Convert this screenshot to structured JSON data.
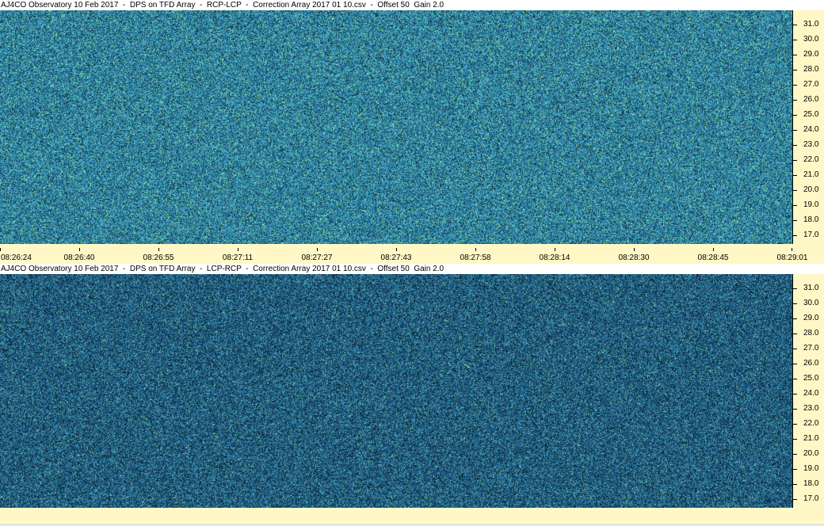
{
  "panels": [
    {
      "title": "AJ4CO Observatory 10 Feb 2017  -  DPS on TFD Array  -  RCP-LCP  -  Correction Array 2017 01 10.csv  -  Offset 50  Gain 2.0",
      "freq_labels": [
        "31.0",
        "30.0",
        "29.0",
        "28.0",
        "27.0",
        "26.0",
        "25.0",
        "24.0",
        "23.0",
        "22.0",
        "21.0",
        "20.0",
        "19.0",
        "18.0",
        "17.0"
      ],
      "palette": [
        "#05121f",
        "#0d2a40",
        "#143a55",
        "#1c5a78",
        "#2a7fa3",
        "#3c9fc4",
        "#5fc0c0",
        "#8fe08a",
        "#c2f07a"
      ],
      "mean_level": 0.52
    },
    {
      "title": "AJ4CO Observatory 10 Feb 2017  -  DPS on TFD Array  -  LCP-RCP  -  Correction Array 2017 01 10.csv  -  Offset 50  Gain 2.0",
      "freq_labels": [
        "31.0",
        "30.0",
        "29.0",
        "28.0",
        "27.0",
        "26.0",
        "25.0",
        "24.0",
        "23.0",
        "22.0",
        "21.0",
        "20.0",
        "19.0",
        "18.0",
        "17.0"
      ],
      "palette": [
        "#03101c",
        "#0a2236",
        "#10304a",
        "#174868",
        "#22688d",
        "#3586b0",
        "#55a9b5",
        "#86cf86",
        "#bfe878"
      ],
      "mean_level": 0.42
    }
  ],
  "time_labels": [
    "08:26:24",
    "08:26:40",
    "08:26:55",
    "08:27:11",
    "08:27:27",
    "08:27:43",
    "08:27:58",
    "08:28:14",
    "08:28:30",
    "08:28:45",
    "08:29:01"
  ]
}
